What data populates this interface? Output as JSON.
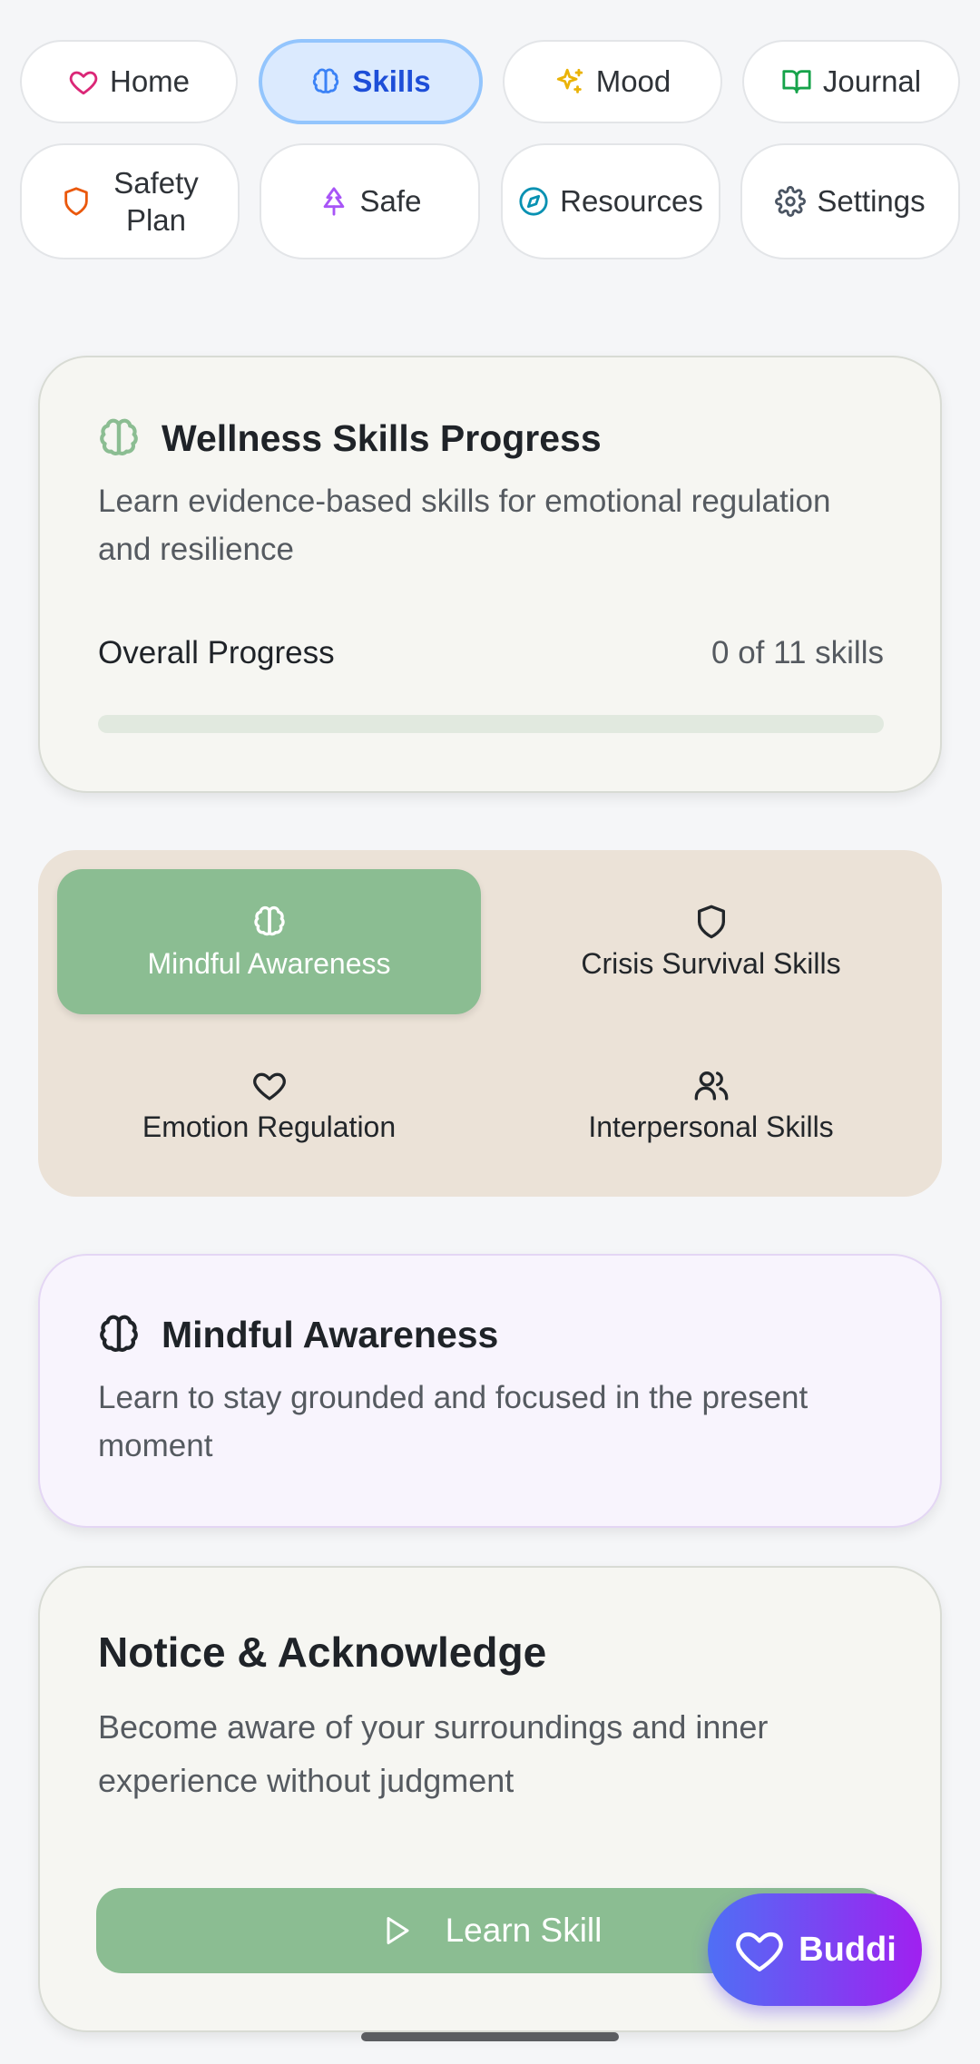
{
  "nav": {
    "items": [
      {
        "label": "Home",
        "icon": "heart-icon",
        "color": "#db2777"
      },
      {
        "label": "Skills",
        "icon": "brain-icon",
        "color": "#3b82f6",
        "active": true
      },
      {
        "label": "Mood",
        "icon": "sparkles-icon",
        "color": "#eab308"
      },
      {
        "label": "Journal",
        "icon": "book-open-icon",
        "color": "#16a34a"
      },
      {
        "label": "Safety Plan",
        "line1": "Safety",
        "line2": "Plan",
        "icon": "shield-icon",
        "color": "#ea580c"
      },
      {
        "label": "Safe",
        "icon": "tree-icon",
        "color": "#a855f7"
      },
      {
        "label": "Resources",
        "icon": "compass-icon",
        "color": "#0891b2"
      },
      {
        "label": "Settings",
        "icon": "gear-icon",
        "color": "#4b5563"
      }
    ]
  },
  "progress_card": {
    "title": "Wellness Skills Progress",
    "subtitle": "Learn evidence-based skills for emotional regulation and resilience",
    "progress_label": "Overall Progress",
    "progress_count": "0 of 11 skills",
    "progress_fraction": 0
  },
  "tabs": [
    {
      "label": "Mindful Awareness",
      "icon": "brain-icon",
      "active": true
    },
    {
      "label": "Crisis Survival Skills",
      "icon": "shield-icon"
    },
    {
      "label": "Emotion Regulation",
      "icon": "heart-icon"
    },
    {
      "label": "Interpersonal Skills",
      "icon": "users-icon"
    }
  ],
  "section_card": {
    "title": "Mindful Awareness",
    "subtitle": "Learn to stay grounded and focused in the present moment"
  },
  "skill_card": {
    "title": "Notice & Acknowledge",
    "description": "Become aware of your surroundings and inner experience without judgment",
    "button_label": "Learn Skill"
  },
  "buddi": {
    "label": "Buddi"
  },
  "colors": {
    "accent_green": "#8bbd92",
    "active_nav_bg": "#dbeafe",
    "active_nav_border": "#93c5fd",
    "tabs_bg": "#ebe2d7",
    "section_card_bg": "#f8f4fd",
    "buddi_gradient": [
      "#4f6ff5",
      "#a020f0"
    ]
  }
}
